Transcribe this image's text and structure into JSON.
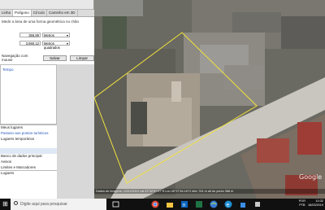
{
  "dialog": {
    "tabs": [
      "Linha",
      "Polígono",
      "Círculo",
      "Caminho em 3D",
      "Polígono em 3D"
    ],
    "active_tab": 1,
    "description": "Medir a área de uma forma geométrica no chão",
    "measurements": [
      {
        "value": "356,89",
        "unit": "Metros"
      },
      {
        "value": "3.960,12",
        "unit": "Metros quadrados"
      }
    ],
    "mouse_nav_label": "Navegação com mouse",
    "clear_button": "Salvar",
    "cancel_button": "Limpar"
  },
  "sidebar": {
    "places_item": "Tempo",
    "layers": [
      {
        "label": "Meus lugares",
        "link": false
      },
      {
        "label": "Passeio aos pontos turísticos",
        "link": true
      },
      {
        "label": "Lugares temporários",
        "link": false
      },
      {
        "label": "",
        "link": false
      },
      {
        "label": "",
        "link": false
      },
      {
        "label": "Banco de dados principal",
        "link": false
      },
      {
        "label": "Avisos",
        "link": false
      },
      {
        "label": "Limites e Marcadores",
        "link": false
      }
    ],
    "bottom_label": "Lugares"
  },
  "map": {
    "status_text": "Dados de imagens: 12/01/2019   Lat 23°32'57.97\"S   Lon 46°37'46.16\"O   elev 761 m   alt do ponto 388 m",
    "watermark": "Google",
    "polygon_color": "#f2e23a"
  },
  "taskbar": {
    "search_placeholder": "Digite aqui para pesquisar",
    "language": "POR",
    "keyboard": "PTB",
    "time": "10:32",
    "date": "18/03/2019"
  }
}
